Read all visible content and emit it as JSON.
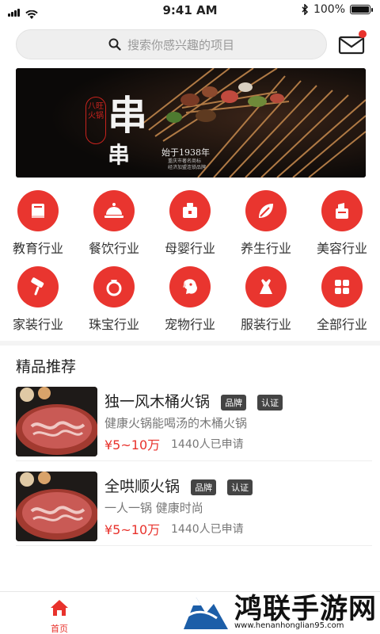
{
  "status": {
    "time": "9:41 AM",
    "battery_text": "100%",
    "battery_level": 1.0
  },
  "search": {
    "placeholder": "搜索你感兴趣的项目",
    "icon": "search-icon"
  },
  "header": {
    "mail_icon": "mail-icon",
    "has_notification": true
  },
  "banner": {
    "title_1": "串",
    "title_2": "串",
    "seal": "八旺火锅",
    "subtitle": "始于1938年",
    "note_1": "重庆市著名商标",
    "note_2": "经济加盟连锁品牌"
  },
  "categories": [
    {
      "label": "教育行业",
      "icon": "book-icon"
    },
    {
      "label": "餐饮行业",
      "icon": "dish-cover-icon"
    },
    {
      "label": "母婴行业",
      "icon": "baby-icon"
    },
    {
      "label": "养生行业",
      "icon": "leaf-icon"
    },
    {
      "label": "美容行业",
      "icon": "cosmetics-icon"
    },
    {
      "label": "家装行业",
      "icon": "paint-roller-icon"
    },
    {
      "label": "珠宝行业",
      "icon": "ring-icon"
    },
    {
      "label": "宠物行业",
      "icon": "dog-icon"
    },
    {
      "label": "服装行业",
      "icon": "dress-icon"
    },
    {
      "label": "全部行业",
      "icon": "grid-icon"
    }
  ],
  "section": {
    "title": "精品推荐"
  },
  "items": [
    {
      "name": "独一风木桶火锅",
      "tags": [
        "品牌",
        "认证"
      ],
      "desc": "健康火锅能喝汤的木桶火锅",
      "price": "¥5~10万",
      "applicants": "1440人已申请"
    },
    {
      "name": "全哄顺火锅",
      "tags": [
        "品牌",
        "认证"
      ],
      "desc": "一人一锅 健康时尚",
      "price": "¥5~10万",
      "applicants": "1440人已申请"
    }
  ],
  "tabbar": {
    "home_label": "首页"
  },
  "watermark": {
    "text": "鸿联手游网",
    "url": "www.henanhonglian95.com"
  },
  "colors": {
    "accent": "#e8322c",
    "tag_bg": "#444444"
  }
}
